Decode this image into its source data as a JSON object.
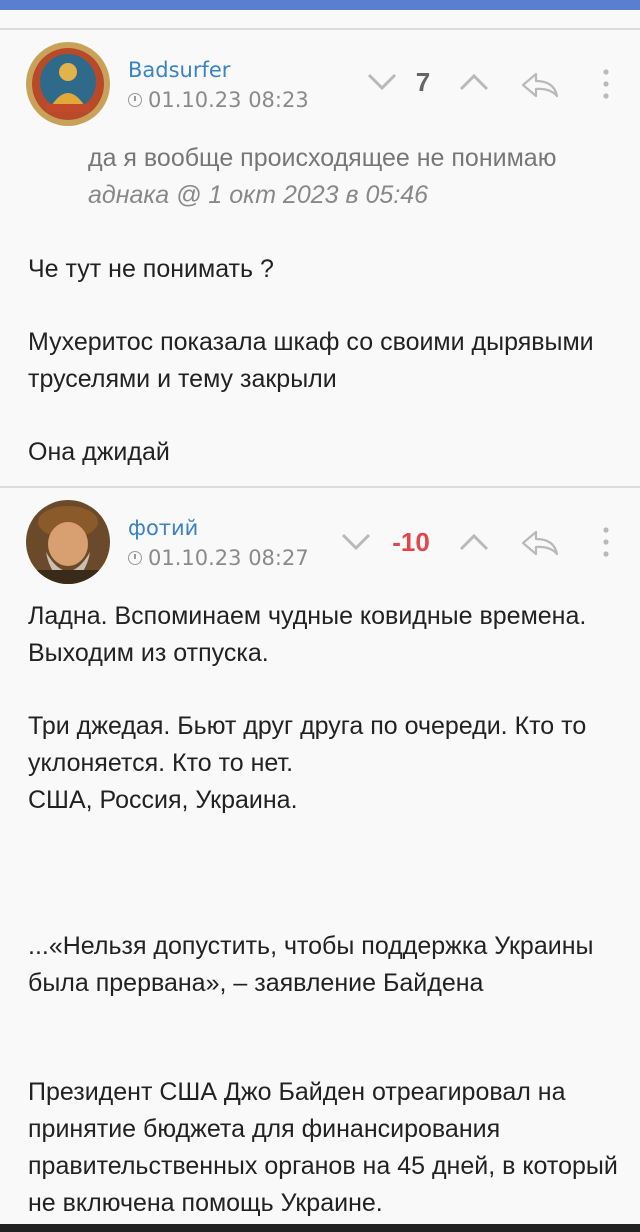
{
  "comments": [
    {
      "username": "Badsurfer",
      "date": "01.10.23 08:23",
      "score": "7",
      "score_color": "#666666",
      "quote": {
        "text": "да я вообще происходящее не понимаю",
        "meta": "аднака @ 1 окт 2023 в 05:46"
      },
      "paragraphs": [
        "Че тут не понимать ?",
        "Мухеритос показала шкаф со своими дырявыми труселями и тему закрыли",
        "Она джидай"
      ]
    },
    {
      "username": "фотий",
      "date": "01.10.23 08:27",
      "score": "-10",
      "score_color": "#e0474c",
      "paragraphs": [
        "Ладна. Вспоминаем чудные ковидные времена. Выходим из отпуска.",
        "Три джедая. Бьют друг друга по очереди. Кто то уклоняется. Кто то нет.",
        "США, Россия, Украина.",
        "...«Нельзя допустить, чтобы поддержка Украины была прервана», – заявление Байдена",
        "Президент США Джо Байден отреагировал на принятие бюджета для финансирования правительственных органов на 45 дней, в который не включена помощь Украине."
      ]
    }
  ],
  "icons": {
    "vote_down": "chevron-down-icon",
    "vote_up": "chevron-up-icon",
    "reply": "reply-arrow-icon",
    "more": "more-vertical-icon",
    "clock": "clock-icon"
  },
  "colors": {
    "accent": "#3b82c4",
    "top_bar": "#5b7fcf",
    "negative": "#e0474c"
  }
}
